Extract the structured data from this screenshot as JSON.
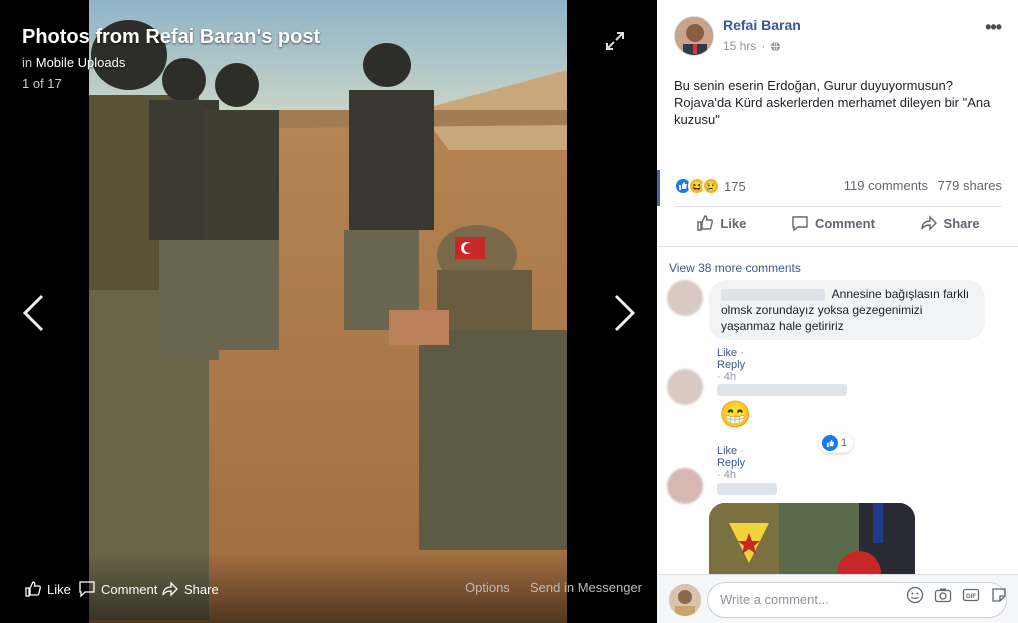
{
  "viewer": {
    "title": "Photos from Refai Baran's post",
    "subtitle_prefix": "in",
    "album": "Mobile Uploads",
    "counter": "1 of 17",
    "actions": {
      "like": "Like",
      "comment": "Comment",
      "share": "Share",
      "options": "Options",
      "messenger": "Send in Messenger"
    }
  },
  "post": {
    "author": "Refai Baran",
    "time": "15 hrs",
    "privacy_icon": "globe-icon",
    "more": "•••",
    "text": "Bu senin eserin Erdoğan, Gurur duyuyormusun? Rojava'da Kürd askerlerden merhamet dileyen bir \"Ana kuzusu\"",
    "reaction_count": "175",
    "comments_count": "119 comments",
    "shares_count": "779 shares",
    "actions": {
      "like": "Like",
      "comment": "Comment",
      "share": "Share"
    }
  },
  "comments": {
    "view_more": "View 38 more comments",
    "items": [
      {
        "text": "Annesine bağışlasın farklı olmsk zorundayız yoksa gezegenimizi yaşanmaz hale getiririz",
        "like": "Like",
        "reply": "Reply",
        "time": "4h"
      },
      {
        "emoji": "😁",
        "like": "Like",
        "reply": "Reply",
        "time": "4h",
        "reaction_count": "1"
      }
    ]
  },
  "composer": {
    "placeholder": "Write a comment..."
  },
  "colors": {
    "link": "#385898",
    "brand": "#4267b2"
  }
}
